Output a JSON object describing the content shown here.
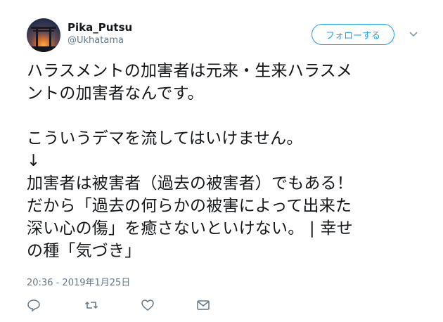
{
  "user": {
    "display_name": "Pika_Putsu",
    "handle": "@Ukhatama"
  },
  "follow_button": {
    "label": "フォローする"
  },
  "tweet": {
    "text": "ハラスメントの加害者は元来・生来ハラスメ\nントの加害者なんです。\n\nこういうデマを流してはいけません。\n↓\n加害者は被害者（過去の被害者）でもある！\nだから「過去の何らかの被害によって出来た\n深い心の傷」を癒さないといけない。 | 幸せ\nの種「気づき」",
    "timestamp": "20:36 - 2019年1月25日"
  },
  "icons": {
    "avatar": "torii-sunset-avatar",
    "menu": "chevron-down-icon",
    "reply": "reply-icon",
    "retweet": "retweet-icon",
    "like": "heart-icon",
    "dm": "envelope-icon"
  },
  "colors": {
    "accent": "#1da1f2",
    "secondary_text": "#657786",
    "text": "#14171a"
  }
}
